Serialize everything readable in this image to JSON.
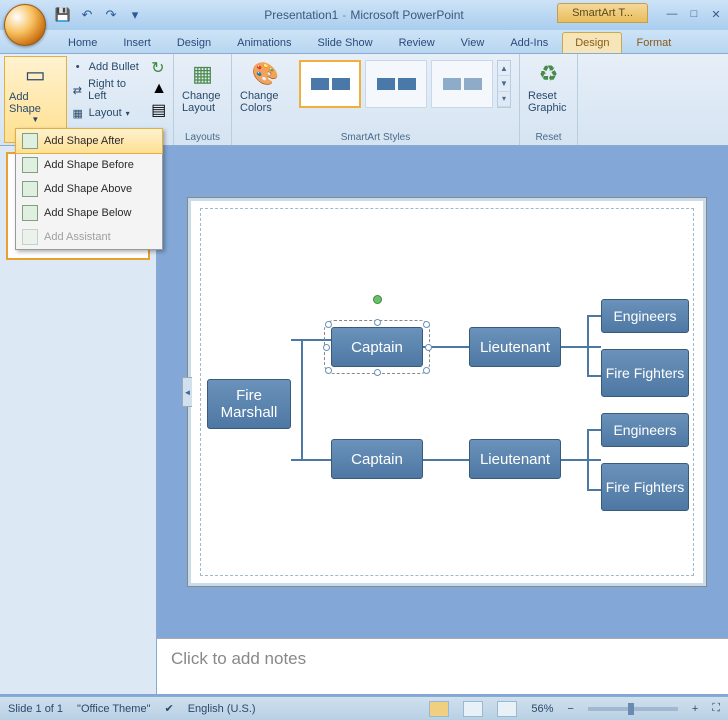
{
  "title": {
    "doc": "Presentation1",
    "app": "Microsoft PowerPoint",
    "context_tools": "SmartArt T..."
  },
  "qat": {
    "save": "💾",
    "undo": "↶",
    "redo": "↷",
    "more": "▾"
  },
  "win": {
    "min": "—",
    "max": "□",
    "close": "✕"
  },
  "tabs": {
    "home": "Home",
    "insert": "Insert",
    "design0": "Design",
    "animations": "Animations",
    "slideshow": "Slide Show",
    "review": "Review",
    "view": "View",
    "addins": "Add-Ins",
    "sa_design": "Design",
    "sa_format": "Format"
  },
  "ribbon": {
    "add_shape": "Add Shape",
    "add_bullet": "Add Bullet",
    "rtl": "Right to Left",
    "layout": "Layout",
    "change_layout": "Change Layout",
    "change_colors": "Change Colors",
    "reset_graphic": "Reset Graphic",
    "grp_layouts": "Layouts",
    "grp_styles": "SmartArt Styles",
    "grp_reset": "Reset"
  },
  "dropdown": {
    "after": "Add Shape After",
    "before": "Add Shape Before",
    "above": "Add Shape Above",
    "below": "Add Shape Below",
    "assistant": "Add Assistant"
  },
  "chart_data": {
    "type": "hierarchy",
    "root": "Fire Marshall",
    "children": [
      {
        "name": "Captain",
        "children": [
          {
            "name": "Lieutenant",
            "children": [
              {
                "name": "Engineers"
              },
              {
                "name": "Fire Fighters"
              }
            ]
          }
        ]
      },
      {
        "name": "Captain",
        "children": [
          {
            "name": "Lieutenant",
            "children": [
              {
                "name": "Engineers"
              },
              {
                "name": "Fire Fighters"
              }
            ]
          }
        ]
      }
    ],
    "selected_path": [
      0
    ]
  },
  "nodes": {
    "root": "Fire Marshall",
    "c1": "Captain",
    "c2": "Captain",
    "l1": "Lieutenant",
    "l2": "Lieutenant",
    "e1": "Engineers",
    "e2": "Engineers",
    "f1": "Fire Fighters",
    "f2": "Fire Fighters"
  },
  "notes_placeholder": "Click to add notes",
  "status": {
    "slide": "Slide 1 of 1",
    "theme": "\"Office Theme\"",
    "lang": "English (U.S.)",
    "zoom": "56%"
  }
}
